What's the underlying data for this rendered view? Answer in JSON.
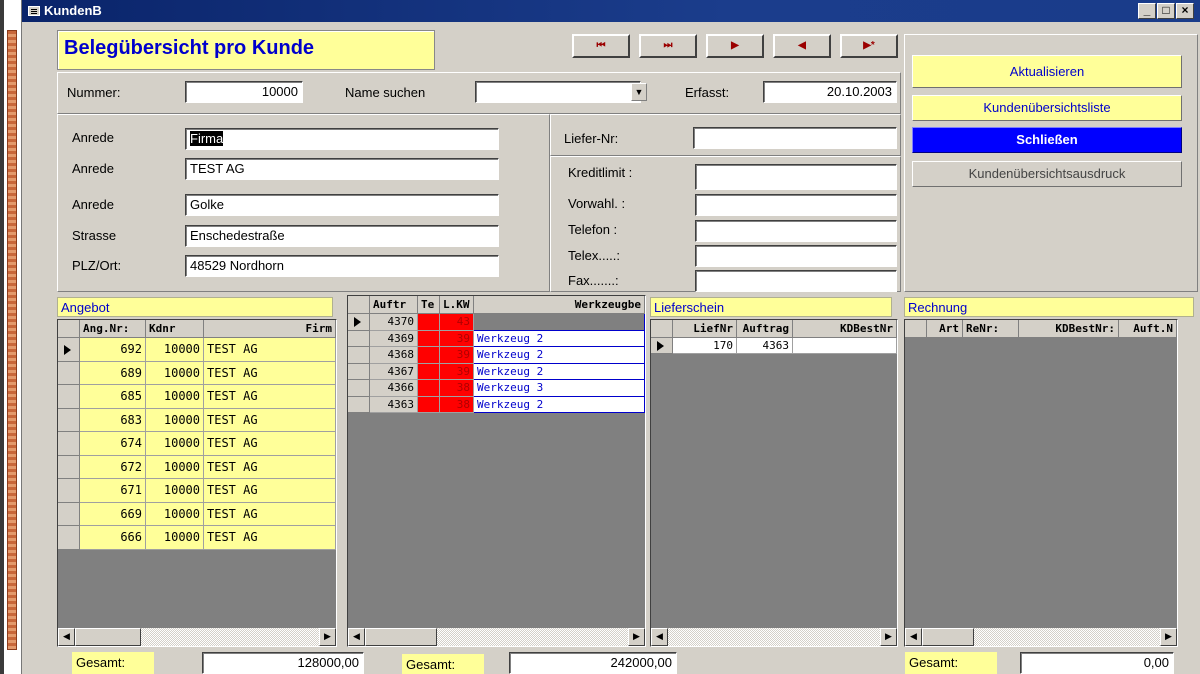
{
  "window": {
    "title": "KundenB",
    "controls": [
      "_",
      "□",
      "×"
    ]
  },
  "form": {
    "title": "Belegübersicht pro Kunde",
    "nav": [
      "⏮",
      "⏭",
      "▶",
      "◀",
      "▶*"
    ]
  },
  "header": {
    "nummer_label": "Nummer:",
    "nummer_value": "10000",
    "name_suchen_label": "Name suchen",
    "name_suchen_value": "",
    "erfasst_label": "Erfasst:",
    "erfasst_value": "20.10.2003"
  },
  "address": {
    "rows": [
      {
        "label": "Anrede",
        "value": "Firma"
      },
      {
        "label": "Anrede",
        "value": "TEST AG"
      },
      {
        "label": "Anrede",
        "value": "Golke"
      },
      {
        "label": "Strasse",
        "value": "Enschedestraße"
      },
      {
        "label": "PLZ/Ort:",
        "value": "48529 Nordhorn"
      }
    ]
  },
  "contact": {
    "liefer_nr_label": "Liefer-Nr:",
    "liefer_nr_value": "",
    "rows": [
      {
        "label": "Kreditlimit :",
        "value": ""
      },
      {
        "label": "Vorwahl. :",
        "value": ""
      },
      {
        "label": "Telefon  :",
        "value": ""
      },
      {
        "label": "Telex.....:",
        "value": ""
      },
      {
        "label": "Fax.......:",
        "value": ""
      }
    ]
  },
  "buttons": {
    "aktualisieren": "Aktualisieren",
    "kundenliste": "Kundenübersichtsliste",
    "schliessen": "Schließen",
    "ausdruck": "Kundenübersichtsausdruck"
  },
  "angebot": {
    "title": "Angebot",
    "columns": [
      "Ang.Nr:",
      "Kdnr",
      "Firm"
    ],
    "rows": [
      [
        "692",
        "10000",
        "TEST AG"
      ],
      [
        "689",
        "10000",
        "TEST AG"
      ],
      [
        "685",
        "10000",
        "TEST AG"
      ],
      [
        "683",
        "10000",
        "TEST AG"
      ],
      [
        "674",
        "10000",
        "TEST AG"
      ],
      [
        "672",
        "10000",
        "TEST AG"
      ],
      [
        "671",
        "10000",
        "TEST AG"
      ],
      [
        "669",
        "10000",
        "TEST AG"
      ],
      [
        "666",
        "10000",
        "TEST AG"
      ]
    ],
    "total_label": "Gesamt:",
    "total_value": "128000,00"
  },
  "auftrag": {
    "columns": [
      "Auftr",
      "Te",
      "L.KW",
      "Werkzeugbe"
    ],
    "rows": [
      [
        "4370",
        "",
        "43",
        ""
      ],
      [
        "4369",
        "",
        "39",
        "Werkzeug 2"
      ],
      [
        "4368",
        "",
        "39",
        "Werkzeug 2"
      ],
      [
        "4367",
        "",
        "39",
        "Werkzeug 2"
      ],
      [
        "4366",
        "",
        "38",
        "Werkzeug 3"
      ],
      [
        "4363",
        "",
        "38",
        "Werkzeug 2"
      ]
    ],
    "total_label": "Gesamt:",
    "total_value": "242000,00"
  },
  "lieferschein": {
    "title": "Lieferschein",
    "columns": [
      "LiefNr",
      "Auftrag",
      "KDBestNr"
    ],
    "rows": [
      [
        "170",
        "4363",
        ""
      ]
    ]
  },
  "rechnung": {
    "title": "Rechnung",
    "columns": [
      "Art",
      "ReNr:",
      "KDBestNr:",
      "Auft.N"
    ],
    "total_label": "Gesamt:",
    "total_value": "0,00"
  },
  "colors": {
    "accent_yellow": "#ffff99",
    "close_blue": "#0000ff",
    "cell_red": "#ff0000",
    "link_blue": "#0000cc"
  }
}
